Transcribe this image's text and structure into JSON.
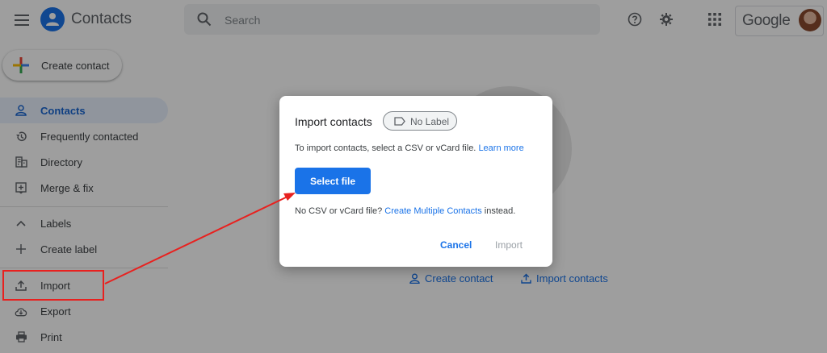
{
  "header": {
    "app_title": "Contacts",
    "search_placeholder": "Search",
    "brand": "Google",
    "icons": [
      "menu-icon",
      "help-icon",
      "settings-icon",
      "apps-grid-icon"
    ]
  },
  "sidebar": {
    "create_label": "Create contact",
    "items": [
      {
        "label": "Contacts",
        "icon": "person-icon",
        "active": true
      },
      {
        "label": "Frequently contacted",
        "icon": "history-icon"
      },
      {
        "label": "Directory",
        "icon": "building-icon"
      },
      {
        "label": "Merge & fix",
        "icon": "merge-icon"
      },
      {
        "label": "Labels",
        "icon": "chevron-up-icon"
      },
      {
        "label": "Create label",
        "icon": "plus-icon"
      },
      {
        "label": "Import",
        "icon": "upload-icon"
      },
      {
        "label": "Export",
        "icon": "cloud-download-icon"
      },
      {
        "label": "Print",
        "icon": "print-icon"
      }
    ]
  },
  "main": {
    "create_contact_link": "Create contact",
    "import_contacts_link": "Import contacts"
  },
  "dialog": {
    "title": "Import contacts",
    "chip_label": "No Label",
    "text1": "To import contacts, select a CSV or vCard file.",
    "learn_more": "Learn more",
    "select_file": "Select file",
    "text2_pre": "No CSV or vCard file?",
    "text2_link": "Create Multiple Contacts",
    "text2_post": "instead.",
    "cancel": "Cancel",
    "import": "Import"
  },
  "annotation_color": "#e8211f",
  "accent_color": "#1a73e8"
}
